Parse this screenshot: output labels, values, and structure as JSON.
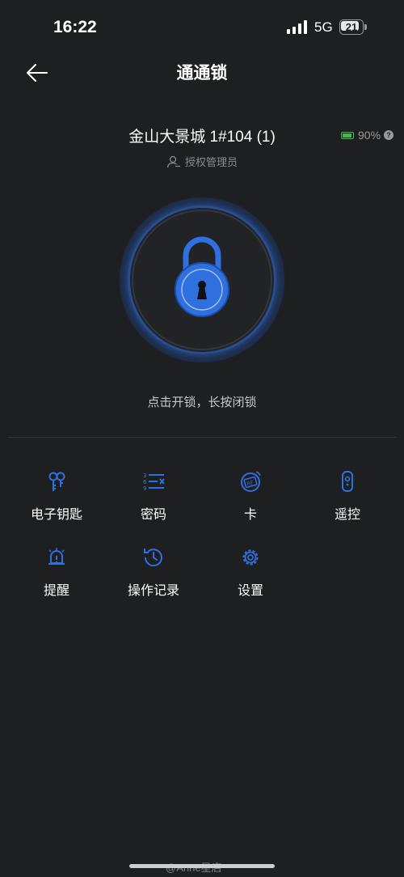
{
  "status": {
    "time": "16:22",
    "network": "5G",
    "battery": "21"
  },
  "nav": {
    "title": "通通锁",
    "back_icon": "arrow-left-icon"
  },
  "lock": {
    "name": "金山大景城 1#104 (1)",
    "battery": "90%",
    "role": "授权管理员",
    "hint": "点击开锁，长按闭锁"
  },
  "features": [
    {
      "label": "电子钥匙",
      "icon": "key-icon"
    },
    {
      "label": "密码",
      "icon": "password-icon"
    },
    {
      "label": "卡",
      "icon": "card-icon"
    },
    {
      "label": "遥控",
      "icon": "remote-icon"
    },
    {
      "label": "提醒",
      "icon": "alarm-bell-icon"
    },
    {
      "label": "操作记录",
      "icon": "history-icon"
    },
    {
      "label": "设置",
      "icon": "settings-icon"
    }
  ],
  "colors": {
    "accent": "#2f6fde",
    "background": "#1e1f21",
    "battery_ok": "#3fb950"
  },
  "watermark": "@Anne星店"
}
